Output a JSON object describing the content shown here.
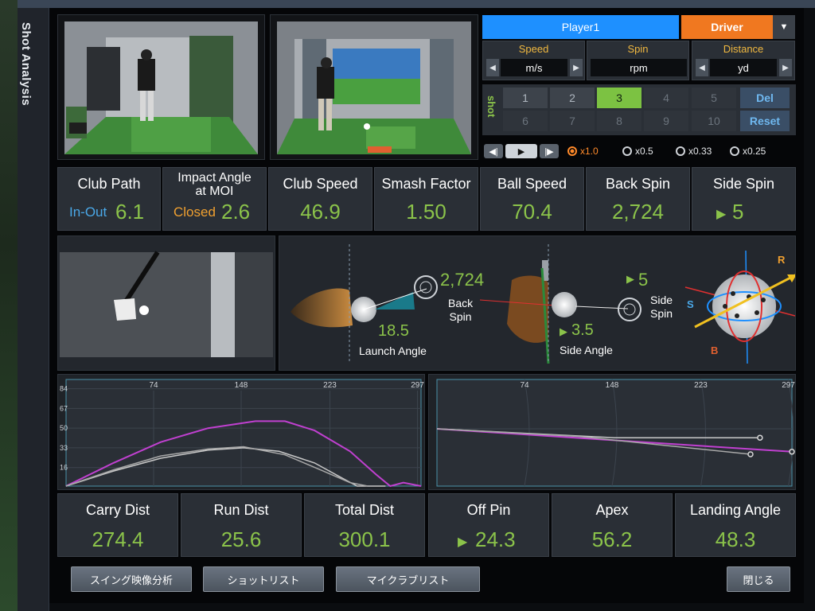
{
  "window": {
    "title": "Shot Analysis"
  },
  "player": {
    "name": "Player1",
    "club": "Driver"
  },
  "units": [
    {
      "label": "Speed",
      "value": "m/s"
    },
    {
      "label": "Spin",
      "value": "rpm"
    },
    {
      "label": "Distance",
      "value": "yd"
    }
  ],
  "shots": {
    "label": "shot",
    "row1": [
      "1",
      "2",
      "3",
      "4",
      "5"
    ],
    "row2": [
      "6",
      "7",
      "8",
      "9",
      "10"
    ],
    "selected": "3",
    "del_label": "Del",
    "reset_label": "Reset"
  },
  "playback": {
    "speeds": [
      "x1.0",
      "x0.5",
      "x0.33",
      "x0.25"
    ],
    "selected": "x1.0"
  },
  "metrics_top": [
    {
      "label": "Club Path",
      "prefix": "In-Out",
      "value": "6.1"
    },
    {
      "label": "Impact Angle\nat MOI",
      "prefix": "Closed",
      "value": "2.6"
    },
    {
      "label": "Club Speed",
      "value": "46.9"
    },
    {
      "label": "Smash Factor",
      "value": "1.50"
    },
    {
      "label": "Ball Speed",
      "value": "70.4"
    },
    {
      "label": "Back Spin",
      "value": "2,724"
    },
    {
      "label": "Side Spin",
      "value": "5"
    }
  ],
  "impact": {
    "back_spin_value": "2,724",
    "back_spin_label": "Back\nSpin",
    "launch_angle_value": "18.5",
    "launch_angle_label": "Launch Angle",
    "side_spin_value": "5",
    "side_spin_label": "Side\nSpin",
    "side_angle_value": "3.5",
    "side_angle_label": "Side Angle",
    "axis_labels": {
      "r": "R",
      "s": "S",
      "b": "B"
    }
  },
  "chart_data": [
    {
      "type": "line",
      "name": "side-view trajectory",
      "x_ticks": [
        "74",
        "148",
        "223",
        "297"
      ],
      "y_ticks": [
        "84",
        "67",
        "50",
        "33",
        "16"
      ],
      "series": [
        {
          "color": "#c040d0",
          "points": [
            [
              0,
              0
            ],
            [
              40,
              20
            ],
            [
              80,
              38
            ],
            [
              120,
              50
            ],
            [
              160,
              56
            ],
            [
              185,
              56
            ],
            [
              210,
              48
            ],
            [
              240,
              30
            ],
            [
              262,
              10
            ],
            [
              274,
              0
            ],
            [
              285,
              3
            ],
            [
              300,
              0
            ]
          ]
        },
        {
          "color": "#c8c8c8",
          "points": [
            [
              0,
              0
            ],
            [
              40,
              13
            ],
            [
              80,
              24
            ],
            [
              120,
              31
            ],
            [
              150,
              33
            ],
            [
              180,
              30
            ],
            [
              210,
              20
            ],
            [
              235,
              6
            ],
            [
              246,
              0
            ],
            [
              270,
              0
            ]
          ]
        },
        {
          "color": "#a8a8a8",
          "points": [
            [
              0,
              0
            ],
            [
              40,
              14
            ],
            [
              80,
              26
            ],
            [
              120,
              32
            ],
            [
              150,
              34
            ],
            [
              185,
              27
            ],
            [
              215,
              14
            ],
            [
              240,
              3
            ],
            [
              255,
              0
            ]
          ]
        }
      ]
    },
    {
      "type": "line",
      "name": "top-view trajectory",
      "x_ticks": [
        "74",
        "148",
        "223",
        "297"
      ],
      "series": [
        {
          "color": "#c040d0",
          "points": [
            [
              0,
              0
            ],
            [
              300,
              -18
            ]
          ]
        },
        {
          "color": "#c8c8c8",
          "points": [
            [
              0,
              0
            ],
            [
              150,
              -7
            ],
            [
              273,
              -7
            ]
          ]
        },
        {
          "color": "#a8a8a8",
          "points": [
            [
              0,
              0
            ],
            [
              120,
              -6
            ],
            [
              265,
              -20
            ]
          ]
        }
      ]
    }
  ],
  "metrics_bottom": [
    {
      "label": "Carry Dist",
      "value": "274.4"
    },
    {
      "label": "Run Dist",
      "value": "25.6"
    },
    {
      "label": "Total Dist",
      "value": "300.1"
    },
    {
      "label": "Off Pin",
      "value": "24.3"
    },
    {
      "label": "Apex",
      "value": "56.2"
    },
    {
      "label": "Landing Angle",
      "value": "48.3"
    }
  ],
  "buttons": {
    "swing_video": "スイング映像分析",
    "shot_list": "ショットリスト",
    "my_club_list": "マイクラブリスト",
    "close": "閉じる"
  },
  "colors": {
    "accent_green": "#8bc34a",
    "player_blue": "#1e90ff",
    "club_orange": "#f07820",
    "in_out_blue": "#4aa8e8",
    "closed_orange": "#f0a030",
    "carry_magenta": "#c040d0"
  }
}
